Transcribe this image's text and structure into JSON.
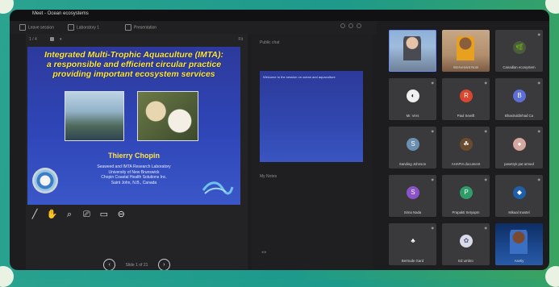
{
  "app": {
    "title": "Meet - Ocean ecosystems"
  },
  "toolbar": {
    "item1": "Leave session",
    "item2": "Laboratory 1",
    "item3": "Presentation"
  },
  "presentation": {
    "slide_number": "1 / 4",
    "zoom": "Fit",
    "slide": {
      "title_line1": "Integrated Multi-Trophic Aquaculture (IMTA):",
      "title_line2": "a responsible and efficient circular practice",
      "title_line3": "providing important ecosystem services",
      "presenter": "Thierry Chopin",
      "info_line1": "Seaweed and IMTA Research Laboratory",
      "info_line2": "University of New Brunswick",
      "info_line3": "Chopin Coastal Health Solutions Inc.",
      "info_line4": "Saint John, N.B., Canada"
    },
    "pager": {
      "prev": "‹",
      "page": "Slide 1 of 21",
      "next": "›"
    },
    "tools": [
      "pen",
      "hand",
      "zoom",
      "screen",
      "display",
      "minus"
    ]
  },
  "middle": {
    "label_top": "Public chat",
    "chat_line": "Welcome to the session on ocean and aquaculture",
    "label_bottom": "My Notes"
  },
  "participants": [
    {
      "name": "",
      "kind": "video1"
    },
    {
      "name": "Intervenant Nom",
      "kind": "video2"
    },
    {
      "name": "Canadian ecosystem",
      "avatar": "🌿",
      "color": "#4d5a3c"
    },
    {
      "name": "Mr. Vers",
      "avatar": "◐",
      "color": "#f0f0f0",
      "fg": "#222"
    },
    {
      "name": "Paul Sewift",
      "avatar": "R",
      "color": "#d9472e"
    },
    {
      "name": "Bhasiruldinhad Ca",
      "avatar": "B",
      "color": "#5d6fd6"
    },
    {
      "name": "Sanding Johnson",
      "avatar": "S",
      "color": "#6b8fb0"
    },
    {
      "name": "AHAPIA document",
      "avatar": "☘",
      "color": "#6b4b2f"
    },
    {
      "name": "pasetryk pat armed",
      "avatar": "●",
      "color": "#d4a7a0"
    },
    {
      "name": "Sirna Nada",
      "avatar": "S",
      "color": "#8a53c9"
    },
    {
      "name": "Prapakti Setyapm",
      "avatar": "P",
      "color": "#2f9c6a"
    },
    {
      "name": "Mikaal Inastel",
      "avatar": "◆",
      "color": "#1e5fa8"
    },
    {
      "name": "Bertrude Gard",
      "avatar": "♣",
      "color": "#3a3a3c"
    },
    {
      "name": "Ed umbro",
      "avatar": "✿",
      "color": "#d8dce6",
      "fg": "#5a5a8a"
    },
    {
      "name": "Asetiy",
      "kind": "video3"
    }
  ],
  "colors": {
    "accent": "#2e7d6c",
    "slide_blue": "#2f46b8",
    "title_yellow": "#ffea4a"
  }
}
